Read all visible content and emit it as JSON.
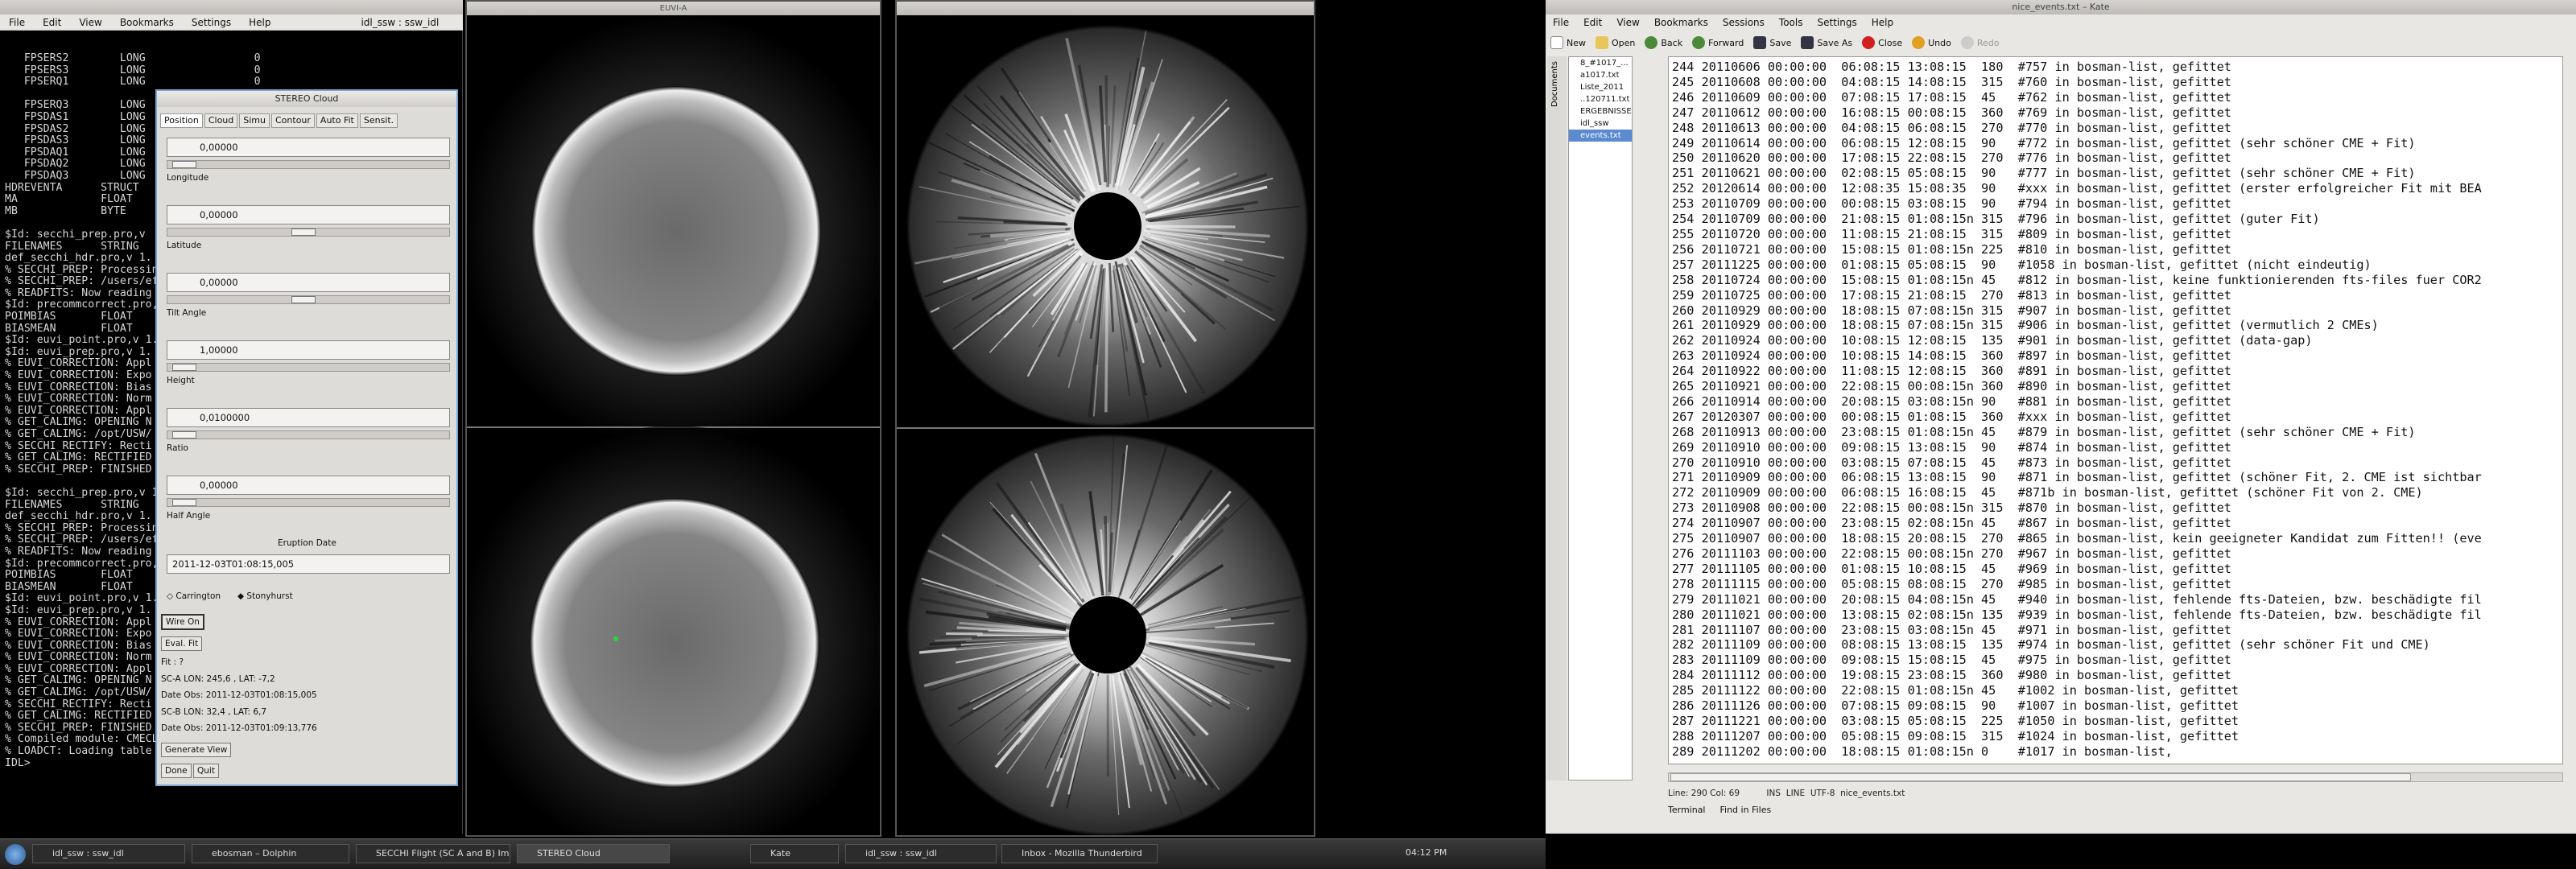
{
  "terminal": {
    "menu": [
      "File",
      "Edit",
      "View",
      "Bookmarks",
      "Settings",
      "Help"
    ],
    "tab_title": "idl_ssw : ssw_idl",
    "lines": [
      "   FPSERS2        LONG                 0",
      "   FPSERS3        LONG                 0",
      "   FPSERQ1        LONG                 0",
      "",
      "   FPSERQ3        LONG",
      "   FPSDAS1        LONG",
      "   FPSDAS2        LONG",
      "   FPSDAS3        LONG",
      "   FPSDAQ1        LONG",
      "   FPSDAQ2        LONG",
      "   FPSDAQ3        LONG",
      "HDREVENTA      STRUCT",
      "MA             FLOAT",
      "MB             BYTE",
      "",
      "$Id: secchi_prep.pro,v",
      "FILENAMES      STRING",
      "def_secchi_hdr.pro,v 1.",
      "% SECCHI_PREP: Processin",
      "% SECCHI_PREP: /users/ef",
      "% READFITS: Now reading",
      "$Id: precommcorrect.pro,",
      "POIMBIAS       FLOAT",
      "BIASMEAN       FLOAT",
      "$Id: euvi_point.pro,v 1.",
      "$Id: euvi_prep.pro,v 1.",
      "% EUVI_CORRECTION: Appl",
      "% EUVI_CORRECTION: Expo",
      "% EUVI_CORRECTION: Bias",
      "% EUVI_CORRECTION: Norm",
      "% EUVI_CORRECTION: Appl",
      "% GET_CALIMG: OPENING N",
      "% GET_CALIMG: /opt/USW/",
      "% SECCHI_RECTIFY: Recti",
      "% GET_CALIMG: RECTIFIED",
      "% SECCHI_PREP: FINISHED",
      "",
      "$Id: secchi_prep.pro,v 1.",
      "FILENAMES      STRING",
      "def_secchi_hdr.pro,v 1.",
      "% SECCHI_PREP: Processin",
      "% SECCHI_PREP: /users/ef",
      "% READFITS: Now reading",
      "$Id: precommcorrect.pro,",
      "POIMBIAS       FLOAT",
      "BIASMEAN       FLOAT",
      "$Id: euvi_point.pro,v 1.",
      "$Id: euvi_prep.pro,v 1.",
      "% EUVI_CORRECTION: Appl",
      "% EUVI_CORRECTION: Expo",
      "% EUVI_CORRECTION: Bias",
      "% EUVI_CORRECTION: Norm",
      "% EUVI_CORRECTION: Appl",
      "% GET_CALIMG: OPENING N",
      "% GET_CALIMG: /opt/USW/",
      "% SECCHI_RECTIFY: Recti",
      "% GET_CALIMG: RECTIFIED",
      "% SECCHI_PREP: FINISHED",
      "% Compiled module: CMECLOUD.",
      "% LOADCT: Loading table B-W LINEAR",
      "IDL>"
    ]
  },
  "dialog": {
    "title": "STEREO Cloud",
    "tabs": [
      "Position",
      "Cloud",
      "Simu",
      "Contour",
      "Auto Fit",
      "Sensit."
    ],
    "fields": [
      {
        "value": "0,00000",
        "label": "Longitude",
        "knob": 0.02
      },
      {
        "value": "0,00000",
        "label": "Latitude",
        "knob": 0.48
      },
      {
        "value": "0,00000",
        "label": "Tilt Angle",
        "knob": 0.48
      },
      {
        "value": "1,00000",
        "label": "Height",
        "knob": 0.02
      },
      {
        "value": "0,0100000",
        "label": "Ratio",
        "knob": 0.02
      },
      {
        "value": "0,00000",
        "label": "Half Angle",
        "knob": 0.02
      }
    ],
    "eruption_label": "Eruption Date",
    "eruption_value": "2011-12-03T01:08:15,005",
    "radio1": "Carrington",
    "radio2": "Stonyhurst",
    "wire_on": "Wire On",
    "eval_fit": "Eval. Fit",
    "fit": "Fit : ?",
    "sca_lon": "SC-A LON:  245,6 , LAT:  -7,2",
    "date_obs1": "Date Obs: 2011-12-03T01:08:15,005",
    "scb_lon": "SC-B LON:   32,4 , LAT:   6,7",
    "date_obs2": "Date Obs: 2011-12-03T01:09:13,776",
    "generate_view": "Generate View",
    "done": "Done",
    "quit": "Quit"
  },
  "images": {
    "euvi_title": "EUVI-A"
  },
  "kate": {
    "title": "nice_events.txt – Kate",
    "menu": [
      "File",
      "Edit",
      "View",
      "Bookmarks",
      "Sessions",
      "Tools",
      "Settings",
      "Help"
    ],
    "toolbar": [
      "New",
      "Open",
      "Back",
      "Forward",
      "Save",
      "Save As",
      "Close",
      "Undo",
      "Redo"
    ],
    "side_tab": "Documents",
    "tree": [
      {
        "name": "8_#1017_...",
        "sel": false
      },
      {
        "name": "a1017.txt",
        "sel": false
      },
      {
        "name": "Liste_2011",
        "sel": false
      },
      {
        "name": "..120711.txt",
        "sel": false
      },
      {
        "name": "ERGEBNISSE",
        "sel": false
      },
      {
        "name": "idl_ssw",
        "sel": false
      },
      {
        "name": "events.txt",
        "sel": true
      }
    ],
    "lines": [
      "244 20110606 00:00:00  06:08:15 13:08:15  180  #757 in bosman-list, gefittet",
      "245 20110608 00:00:00  04:08:15 14:08:15  315  #760 in bosman-list, gefittet",
      "246 20110609 00:00:00  07:08:15 17:08:15  45   #762 in bosman-list, gefittet",
      "247 20110612 00:00:00  16:08:15 00:08:15  360  #769 in bosman-list, gefittet",
      "248 20110613 00:00:00  04:08:15 06:08:15  270  #770 in bosman-list, gefittet",
      "249 20110614 00:00:00  06:08:15 12:08:15  90   #772 in bosman-list, gefittet (sehr schöner CME + Fit)",
      "250 20110620 00:00:00  17:08:15 22:08:15  270  #776 in bosman-list, gefittet",
      "251 20110621 00:00:00  02:08:15 05:08:15  90   #777 in bosman-list, gefittet (sehr schöner CME + Fit)",
      "252 20120614 00:00:00  12:08:35 15:08:35  90   #xxx in bosman-list, gefittet (erster erfolgreicher Fit mit BEA",
      "253 20110709 00:00:00  00:08:15 03:08:15  90   #794 in bosman-list, gefittet",
      "254 20110709 00:00:00  21:08:15 01:08:15n 315  #796 in bosman-list, gefittet (guter Fit)",
      "255 20110720 00:00:00  11:08:15 21:08:15  315  #809 in bosman-list, gefittet",
      "256 20110721 00:00:00  15:08:15 01:08:15n 225  #810 in bosman-list, gefittet",
      "257 20111225 00:00:00  01:08:15 05:08:15  90   #1058 in bosman-list, gefittet (nicht eindeutig)",
      "258 20110724 00:00:00  15:08:15 01:08:15n 45   #812 in bosman-list, keine funktionierenden fts-files fuer COR2",
      "259 20110725 00:00:00  17:08:15 21:08:15  270  #813 in bosman-list, gefittet",
      "260 20110929 00:00:00  18:08:15 07:08:15n 315  #907 in bosman-list, gefittet",
      "261 20110929 00:00:00  18:08:15 07:08:15n 315  #906 in bosman-list, gefittet (vermutlich 2 CMEs)",
      "262 20110924 00:00:00  10:08:15 12:08:15  135  #901 in bosman-list, gefittet (data-gap)",
      "263 20110924 00:00:00  10:08:15 14:08:15  360  #897 in bosman-list, gefittet",
      "264 20110922 00:00:00  11:08:15 12:08:15  360  #891 in bosman-list, gefittet",
      "265 20110921 00:00:00  22:08:15 00:08:15n 360  #890 in bosman-list, gefittet",
      "266 20110914 00:00:00  20:08:15 03:08:15n 90   #881 in bosman-list, gefittet",
      "267 20120307 00:00:00  00:08:15 01:08:15  360  #xxx in bosman-list, gefittet",
      "268 20110913 00:00:00  23:08:15 01:08:15n 45   #879 in bosman-list, gefittet (sehr schöner CME + Fit)",
      "269 20110910 00:00:00  09:08:15 13:08:15  90   #874 in bosman-list, gefittet",
      "270 20110910 00:00:00  03:08:15 07:08:15  45   #873 in bosman-list, gefittet",
      "271 20110909 00:00:00  06:08:15 13:08:15  90   #871 in bosman-list, gefittet (schöner Fit, 2. CME ist sichtbar",
      "272 20110909 00:00:00  06:08:15 16:08:15  45   #871b in bosman-list, gefittet (schöner Fit von 2. CME)",
      "273 20110908 00:00:00  22:08:15 00:08:15n 315  #870 in bosman-list, gefittet",
      "274 20110907 00:00:00  23:08:15 02:08:15n 45   #867 in bosman-list, gefittet",
      "275 20110907 00:00:00  18:08:15 20:08:15  270  #865 in bosman-list, kein geeigneter Kandidat zum Fitten!! (eve",
      "276 20111103 00:00:00  22:08:15 00:08:15n 270  #967 in bosman-list, gefittet",
      "277 20111105 00:00:00  01:08:15 10:08:15  45   #969 in bosman-list, gefittet",
      "278 20111115 00:00:00  05:08:15 08:08:15  270  #985 in bosman-list, gefittet",
      "279 20111021 00:00:00  20:08:15 04:08:15n 45   #940 in bosman-list, fehlende fts-Dateien, bzw. beschädigte fil",
      "280 20111021 00:00:00  13:08:15 02:08:15n 135  #939 in bosman-list, fehlende fts-Dateien, bzw. beschädigte fil",
      "281 20111107 00:00:00  23:08:15 03:08:15n 45   #971 in bosman-list, gefittet",
      "282 20111109 00:00:00  08:08:15 13:08:15  135  #974 in bosman-list, gefittet (sehr schöner Fit und CME)",
      "283 20111109 00:00:00  09:08:15 15:08:15  45   #975 in bosman-list, gefittet",
      "284 20111112 00:00:00  19:08:15 23:08:15  360  #980 in bosman-list, gefittet",
      "285 20111122 00:00:00  22:08:15 01:08:15n 45   #1002 in bosman-list, gefittet",
      "286 20111126 00:00:00  07:08:15 09:08:15  90   #1007 in bosman-list, gefittet",
      "287 20111221 00:00:00  03:08:15 05:08:15  225  #1050 in bosman-list, gefittet",
      "288 20111207 00:00:00  05:08:15 09:08:15  315  #1024 in bosman-list, gefittet",
      "289 20111202 00:00:00  18:08:15 01:08:15n 0    #1017 in bosman-list,"
    ],
    "status": "Line: 290 Col: 69          INS  LINE  UTF-8  nice_events.txt",
    "bottom_tabs": [
      "Terminal",
      "Find in Files"
    ]
  },
  "taskbar": {
    "tasks": [
      {
        "label": "idl_ssw : ssw_idl",
        "active": false
      },
      {
        "label": "ebosman – Dolphin",
        "active": false
      },
      {
        "label": "SECCHI Flight (SC A and B) Images",
        "active": false
      },
      {
        "label": "STEREO Cloud",
        "active": true
      },
      {
        "label": "Kate",
        "active": false
      },
      {
        "label": "idl_ssw : ssw_idl",
        "active": false
      },
      {
        "label": "Inbox - Mozilla Thunderbird",
        "active": false
      }
    ],
    "clock": "04:12 PM"
  }
}
